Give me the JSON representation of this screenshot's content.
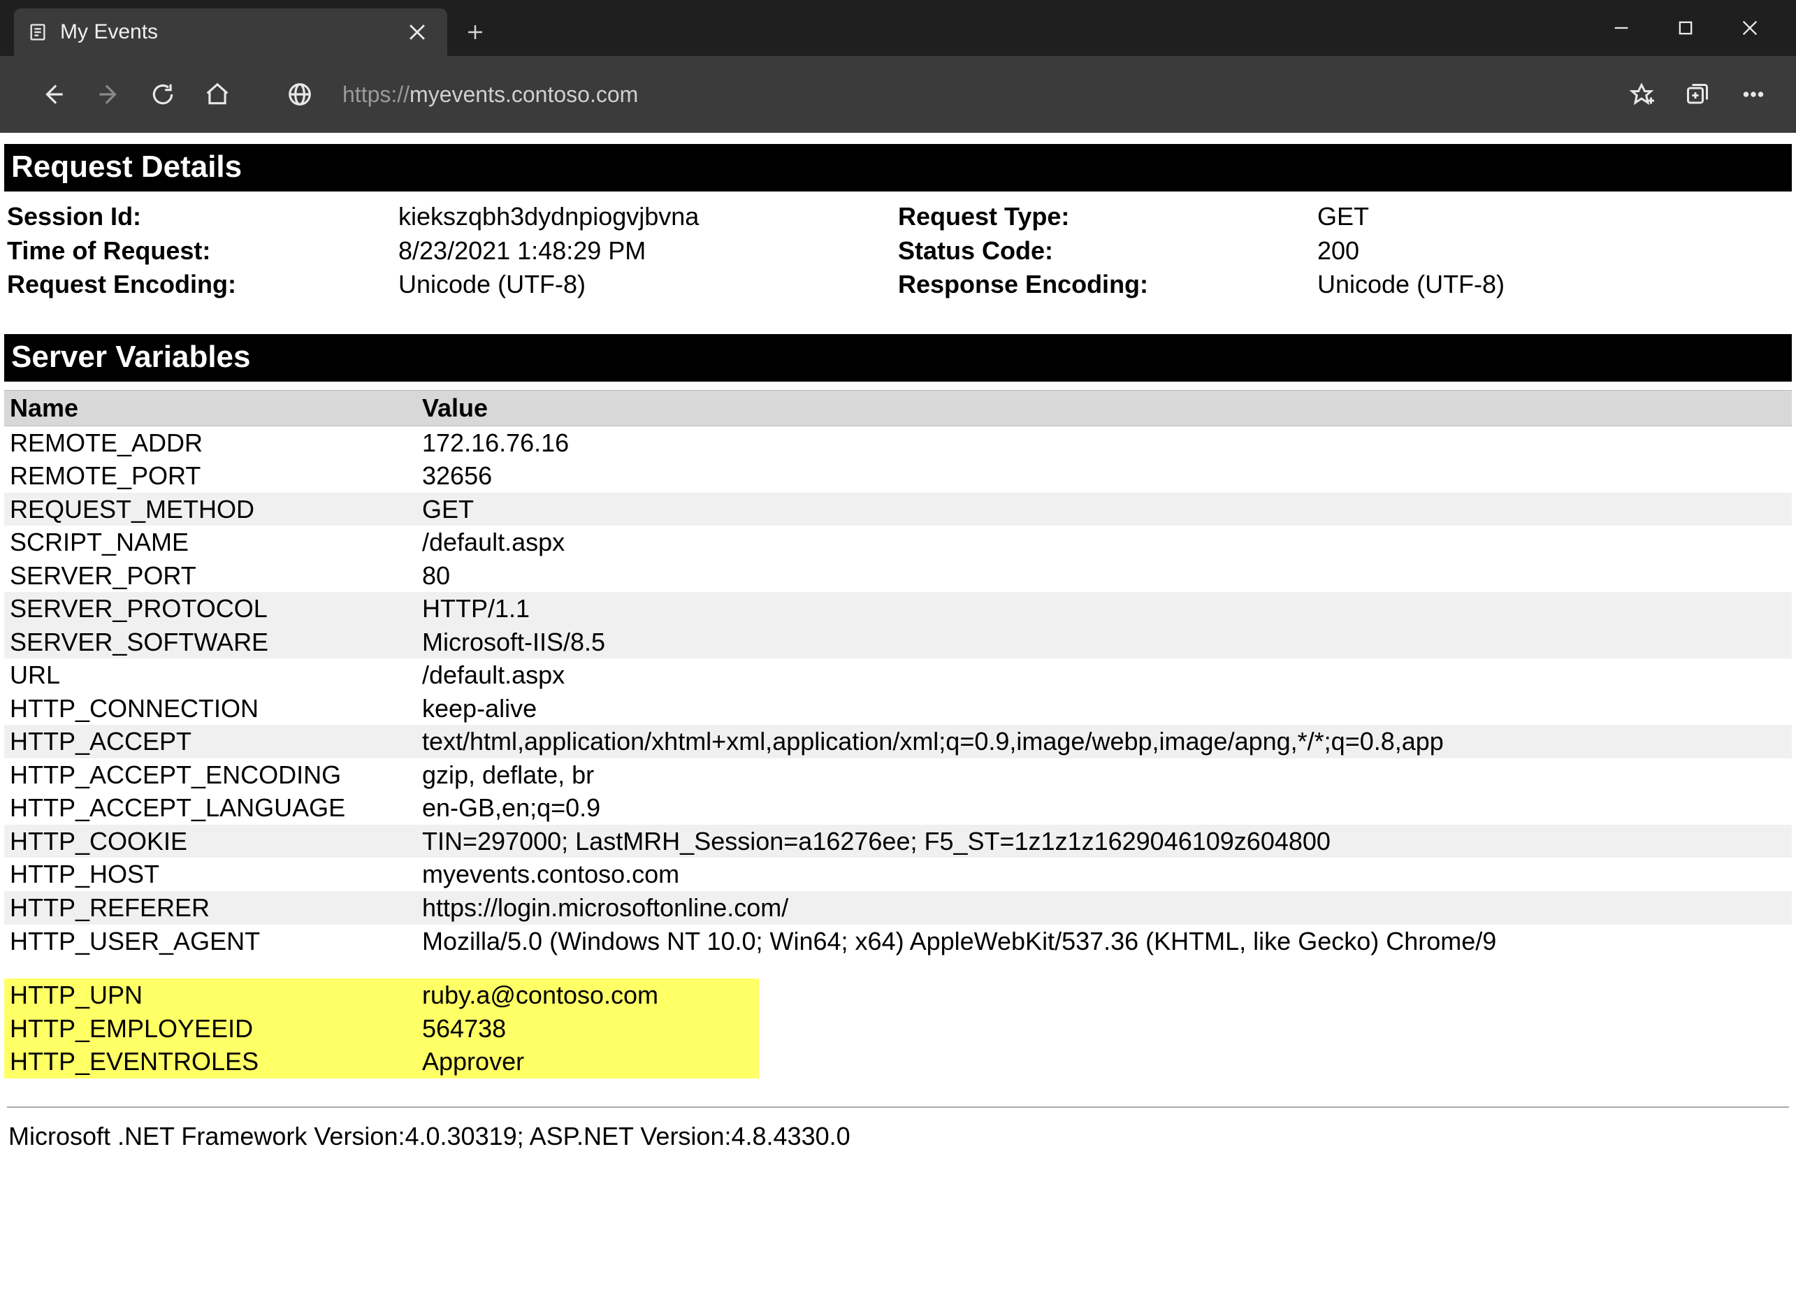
{
  "browser": {
    "tab_title": "My Events",
    "url_scheme": "https://",
    "url_rest": "myevents.contoso.com"
  },
  "sections": {
    "request_details": "Request Details",
    "server_variables": "Server Variables"
  },
  "details": {
    "left": [
      {
        "label": "Session Id:",
        "value": "kiekszqbh3dydnpiogvjbvna"
      },
      {
        "label": "Time of Request:",
        "value": "8/23/2021 1:48:29 PM"
      },
      {
        "label": "Request Encoding:",
        "value": "Unicode (UTF-8)"
      }
    ],
    "right": [
      {
        "label": "Request Type:",
        "value": "GET"
      },
      {
        "label": "Status Code:",
        "value": "200"
      },
      {
        "label": "Response Encoding:",
        "value": "Unicode (UTF-8)"
      }
    ]
  },
  "sv_headers": {
    "name": "Name",
    "value": "Value"
  },
  "server_vars": [
    {
      "name": "REMOTE_ADDR",
      "value": "172.16.76.16"
    },
    {
      "name": "REMOTE_PORT",
      "value": "32656"
    },
    {
      "name": "REQUEST_METHOD",
      "value": "GET"
    },
    {
      "name": "SCRIPT_NAME",
      "value": "/default.aspx"
    },
    {
      "name": "SERVER_PORT",
      "value": "80"
    },
    {
      "name": "SERVER_PROTOCOL",
      "value": "HTTP/1.1"
    },
    {
      "name": "SERVER_SOFTWARE",
      "value": "Microsoft-IIS/8.5"
    },
    {
      "name": "URL",
      "value": "/default.aspx"
    },
    {
      "name": "HTTP_CONNECTION",
      "value": "keep-alive"
    },
    {
      "name": "HTTP_ACCEPT",
      "value": "text/html,application/xhtml+xml,application/xml;q=0.9,image/webp,image/apng,*/*;q=0.8,app"
    },
    {
      "name": "HTTP_ACCEPT_ENCODING",
      "value": "gzip, deflate, br"
    },
    {
      "name": "HTTP_ACCEPT_LANGUAGE",
      "value": "en-GB,en;q=0.9"
    },
    {
      "name": "HTTP_COOKIE",
      "value": "TIN=297000; LastMRH_Session=a16276ee; F5_ST=1z1z1z1629046109z604800"
    },
    {
      "name": "HTTP_HOST",
      "value": "myevents.contoso.com"
    },
    {
      "name": "HTTP_REFERER",
      "value": "https://login.microsoftonline.com/"
    },
    {
      "name": "HTTP_USER_AGENT",
      "value": "Mozilla/5.0 (Windows NT 10.0; Win64; x64) AppleWebKit/537.36 (KHTML, like Gecko) Chrome/9"
    }
  ],
  "highlighted_vars": [
    {
      "name": "HTTP_UPN",
      "value": "ruby.a@contoso.com"
    },
    {
      "name": "HTTP_EMPLOYEEID",
      "value": "564738"
    },
    {
      "name": "HTTP_EVENTROLES",
      "value": "Approver"
    }
  ],
  "footer": "Microsoft .NET Framework Version:4.0.30319; ASP.NET Version:4.8.4330.0"
}
